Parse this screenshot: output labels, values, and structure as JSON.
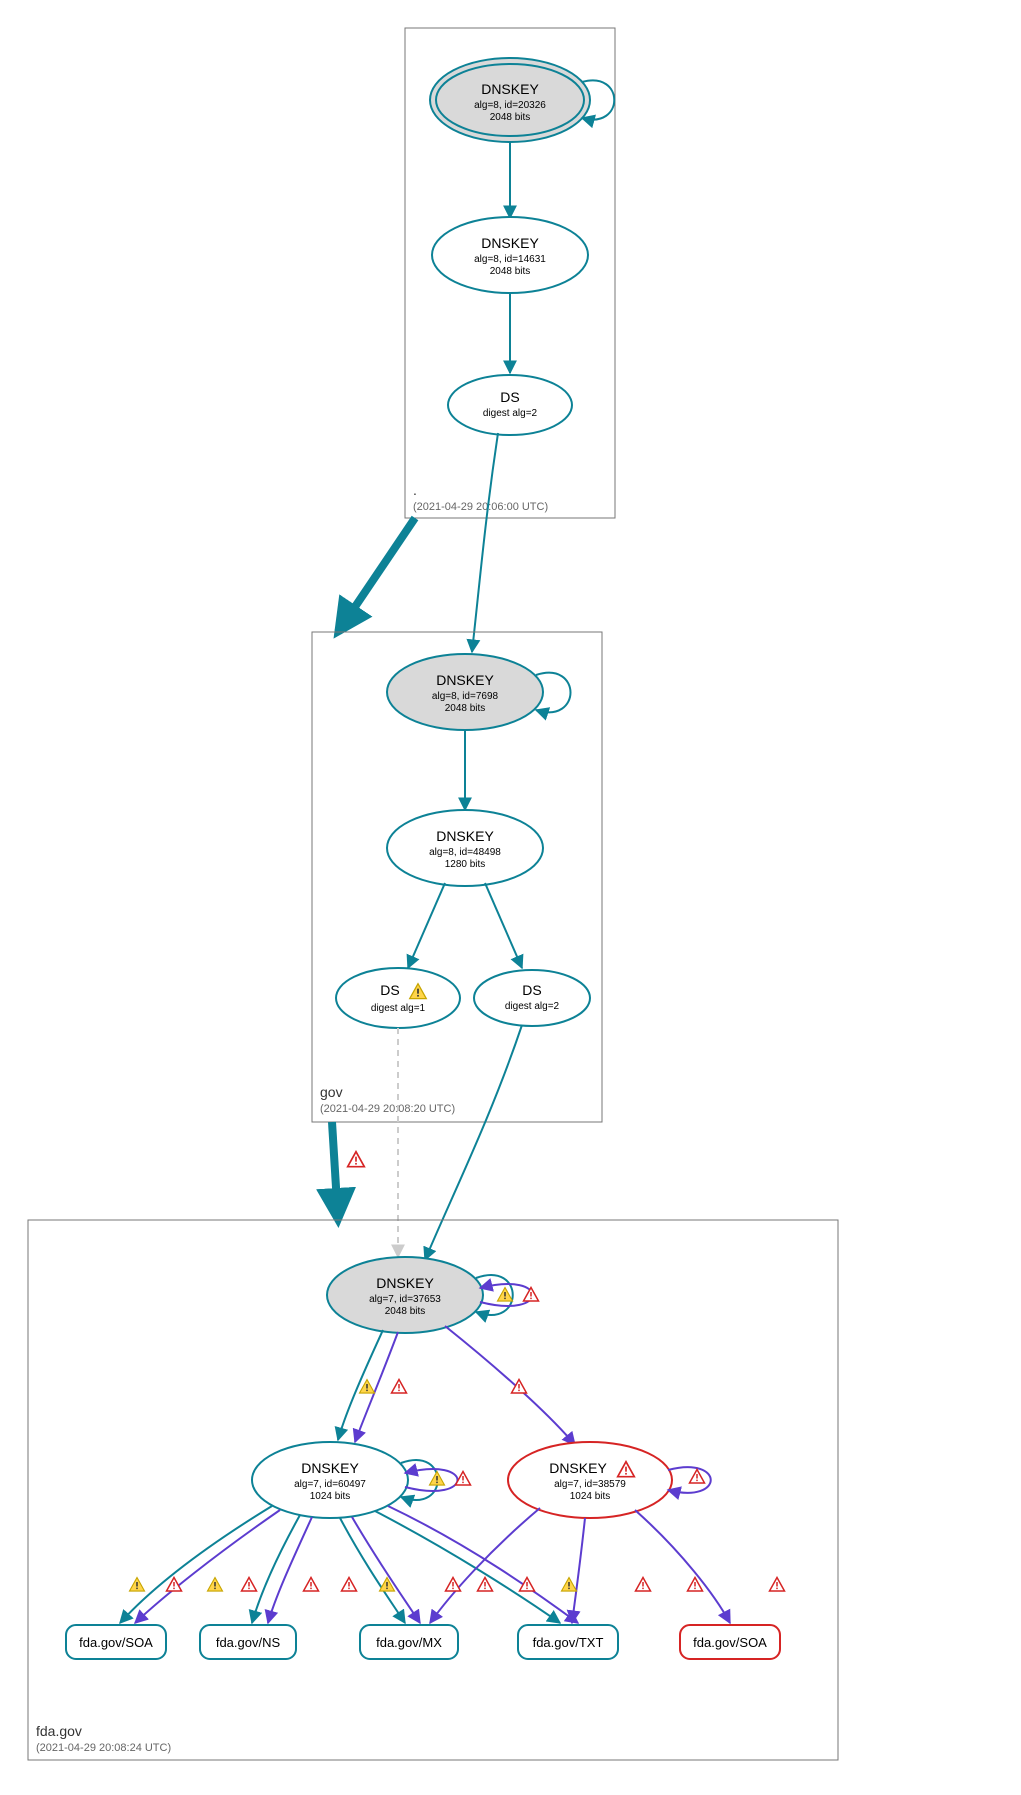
{
  "colors": {
    "teal": "#0d8296",
    "purple": "#5c3ccf",
    "red": "#d62424",
    "grayFill": "#d9d9d9",
    "lightGray": "#cccccc"
  },
  "zones": {
    "root": {
      "label": ".",
      "timestamp": "(2021-04-29 20:06:00 UTC)"
    },
    "gov": {
      "label": "gov",
      "timestamp": "(2021-04-29 20:08:20 UTC)"
    },
    "fda": {
      "label": "fda.gov",
      "timestamp": "(2021-04-29 20:08:24 UTC)"
    }
  },
  "nodes": {
    "root_ksk": {
      "title": "DNSKEY",
      "sub1": "alg=8, id=20326",
      "sub2": "2048 bits"
    },
    "root_zsk": {
      "title": "DNSKEY",
      "sub1": "alg=8, id=14631",
      "sub2": "2048 bits"
    },
    "root_ds": {
      "title": "DS",
      "sub1": "digest alg=2"
    },
    "gov_ksk": {
      "title": "DNSKEY",
      "sub1": "alg=8, id=7698",
      "sub2": "2048 bits"
    },
    "gov_zsk": {
      "title": "DNSKEY",
      "sub1": "alg=8, id=48498",
      "sub2": "1280 bits"
    },
    "gov_ds1": {
      "title": "DS",
      "sub1": "digest alg=1",
      "warn": true
    },
    "gov_ds2": {
      "title": "DS",
      "sub1": "digest alg=2"
    },
    "fda_ksk": {
      "title": "DNSKEY",
      "sub1": "alg=7, id=37653",
      "sub2": "2048 bits"
    },
    "fda_zsk1": {
      "title": "DNSKEY",
      "sub1": "alg=7, id=60497",
      "sub2": "1024 bits"
    },
    "fda_zsk2": {
      "title": "DNSKEY",
      "sub1": "alg=7, id=38579",
      "sub2": "1024 bits",
      "err": true
    }
  },
  "rrsets": {
    "soa1": "fda.gov/SOA",
    "ns": "fda.gov/NS",
    "mx": "fda.gov/MX",
    "txt": "fda.gov/TXT",
    "soa2": "fda.gov/SOA"
  }
}
